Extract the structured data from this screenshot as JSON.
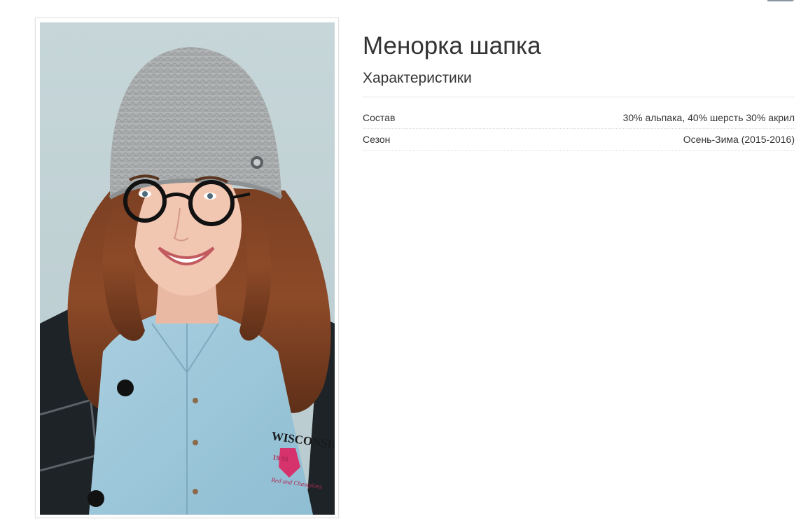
{
  "header": {
    "search": {
      "placeholder": ""
    }
  },
  "product": {
    "title": "Менорка шапка",
    "image_alt": "",
    "characteristics_heading": "Характеристики",
    "specs": [
      {
        "label": "Состав",
        "value": "30% альпака, 40% шерсть 30% акрил"
      },
      {
        "label": "Сезон",
        "value": "Осень-Зима (2015-2016)"
      }
    ]
  },
  "colors": {
    "text": "#333333",
    "divider": "#e5e5e5",
    "search_button": "#8a96a3"
  },
  "photo": {
    "shirt_print_lines": [
      "WISCONSIN",
      "19 90",
      "Red and Champions"
    ]
  }
}
